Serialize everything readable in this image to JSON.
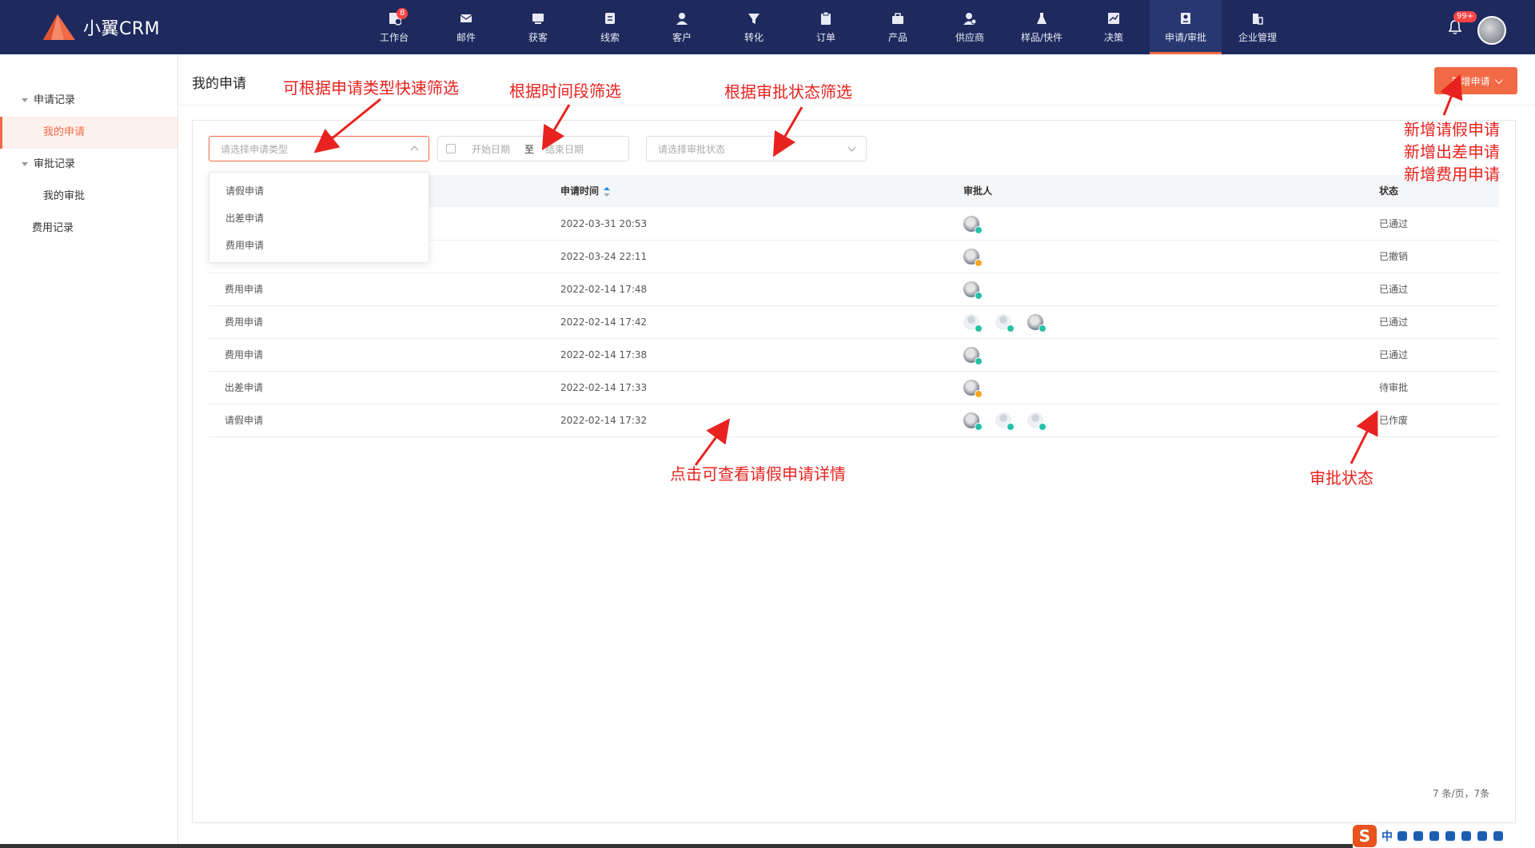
{
  "brand": {
    "name": "小翼CRM"
  },
  "nav": {
    "items": [
      {
        "label": "工作台",
        "icon": "workbench-icon",
        "badge": "8"
      },
      {
        "label": "邮件",
        "icon": "mail-icon"
      },
      {
        "label": "获客",
        "icon": "acquire-icon"
      },
      {
        "label": "线索",
        "icon": "lead-icon"
      },
      {
        "label": "客户",
        "icon": "customer-icon"
      },
      {
        "label": "转化",
        "icon": "funnel-icon"
      },
      {
        "label": "订单",
        "icon": "order-icon"
      },
      {
        "label": "产品",
        "icon": "briefcase-icon"
      },
      {
        "label": "供应商",
        "icon": "supplier-icon"
      },
      {
        "label": "样品/快件",
        "icon": "flask-icon"
      },
      {
        "label": "决策",
        "icon": "chart-icon"
      },
      {
        "label": "申请/审批",
        "icon": "approval-icon",
        "active": true
      },
      {
        "label": "企业管理",
        "icon": "building-icon"
      }
    ],
    "notification_badge": "99+"
  },
  "sidebar": {
    "groups": [
      {
        "label": "申请记录",
        "items": [
          {
            "label": "我的申请",
            "active": true
          }
        ]
      },
      {
        "label": "审批记录",
        "items": [
          {
            "label": "我的审批"
          }
        ]
      }
    ],
    "plain_item": "费用记录"
  },
  "header": {
    "title": "我的申请",
    "new_button": "新增申请"
  },
  "filters": {
    "type_placeholder": "请选择申请类型",
    "start_placeholder": "开始日期",
    "to": "至",
    "end_placeholder": "结束日期",
    "status_placeholder": "请选择审批状态",
    "type_options": [
      "请假申请",
      "出差申请",
      "费用申请"
    ]
  },
  "table": {
    "headers": {
      "time": "申请时间",
      "approver": "审批人",
      "status": "状态"
    },
    "rows": [
      {
        "type": "",
        "time": "2022-03-31 20:53",
        "approvers": [
          {
            "kind": "photo",
            "state": "ok"
          }
        ],
        "status": "已通过"
      },
      {
        "type": "",
        "time": "2022-03-24 22:11",
        "approvers": [
          {
            "kind": "photo",
            "state": "warn"
          }
        ],
        "status": "已撤销"
      },
      {
        "type": "费用申请",
        "time": "2022-02-14 17:48",
        "approvers": [
          {
            "kind": "photo",
            "state": "ok"
          }
        ],
        "status": "已通过"
      },
      {
        "type": "费用申请",
        "time": "2022-02-14 17:42",
        "approvers": [
          {
            "kind": "blank",
            "state": "ok"
          },
          {
            "kind": "blank",
            "state": "ok"
          },
          {
            "kind": "photo",
            "state": "ok"
          }
        ],
        "status": "已通过"
      },
      {
        "type": "费用申请",
        "time": "2022-02-14 17:38",
        "approvers": [
          {
            "kind": "photo",
            "state": "ok"
          }
        ],
        "status": "已通过"
      },
      {
        "type": "出差申请",
        "time": "2022-02-14 17:33",
        "approvers": [
          {
            "kind": "photo",
            "state": "warn"
          }
        ],
        "status": "待审批"
      },
      {
        "type": "请假申请",
        "time": "2022-02-14 17:32",
        "approvers": [
          {
            "kind": "photo",
            "state": "ok"
          },
          {
            "kind": "blank",
            "state": "ok"
          },
          {
            "kind": "blank",
            "state": "ok"
          }
        ],
        "status": "已作废"
      }
    ]
  },
  "pager": {
    "text": "7 条/页，7条"
  },
  "annotations": {
    "type_filter": "可根据申请类型快速筛选",
    "time_filter": "根据时间段筛选",
    "status_filter": "根据审批状态筛选",
    "new_leave": "新增请假申请",
    "new_trip": "新增出差申请",
    "new_expense": "新增费用申请",
    "detail": "点击可查看请假申请详情",
    "approval_status": "审批状态"
  },
  "ime": {
    "label": "中"
  },
  "colors": {
    "topbar": "#1e2a5e",
    "accent": "#f26a45",
    "annotation": "#e8231f",
    "ok": "#26c0a8",
    "warn": "#f5a623"
  }
}
